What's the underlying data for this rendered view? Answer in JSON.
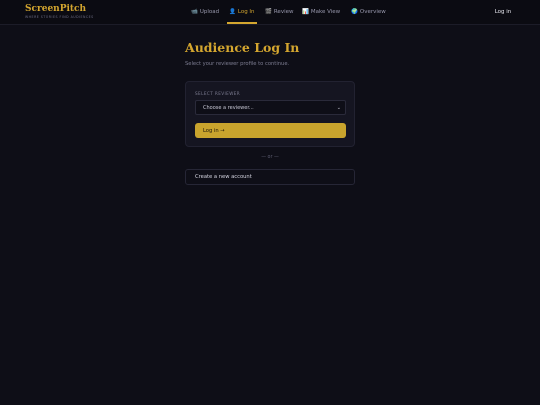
{
  "brand": {
    "name": "ScreenPitch",
    "tagline": "WHERE STORIES FIND AUDIENCES"
  },
  "nav": {
    "items": [
      {
        "label": "Upload",
        "icon": "📹",
        "icon_name": "camera-icon"
      },
      {
        "label": "Log In",
        "icon": "👤",
        "icon_name": "user-icon"
      },
      {
        "label": "Review",
        "icon": "🎬",
        "icon_name": "clapperboard-icon"
      },
      {
        "label": "Make View",
        "icon": "📊",
        "icon_name": "chart-icon"
      },
      {
        "label": "Overview",
        "icon": "🌍",
        "icon_name": "globe-icon"
      }
    ],
    "active": "Log In",
    "login_label": "Log in"
  },
  "main": {
    "title": "Audience Log In",
    "subtitle": "Select your reviewer profile to continue.",
    "card": {
      "label": "SELECT REVIEWER",
      "select_value": "Choose a reviewer...",
      "chevron": "⌄",
      "login_button": "Log in →"
    },
    "or_text": "— or —",
    "create_button": "Create a new account"
  },
  "colors": {
    "background": "#0e0e17",
    "accent": "#d4a62f",
    "card": "#151521"
  }
}
